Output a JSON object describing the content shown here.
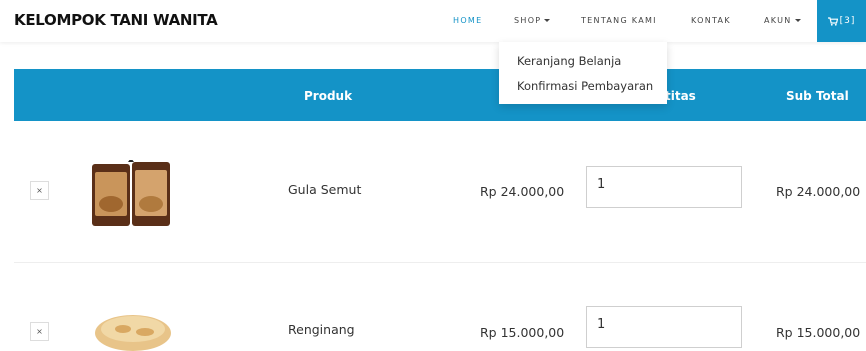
{
  "brand": "KELOMPOK TANI WANITA",
  "nav": {
    "home": "HOME",
    "shop": "SHOP",
    "tentang": "TENTANG KAMI",
    "kontak": "KONTAK",
    "akun": "AKUN",
    "cart_count": "[3]"
  },
  "dropdown": {
    "items": [
      "Keranjang Belanja",
      "Konfirmasi Pembayaran"
    ]
  },
  "table": {
    "headers": {
      "produk": "Produk",
      "kuantitas": "titas",
      "subtotal": "Sub Total"
    },
    "rows": [
      {
        "remove": "×",
        "name": "Gula Semut",
        "price": "Rp 24.000,00",
        "qty": "1",
        "subtotal": "Rp 24.000,00"
      },
      {
        "remove": "×",
        "name": "Renginang",
        "price": "Rp 15.000,00",
        "qty": "1",
        "subtotal": "Rp 15.000,00"
      }
    ]
  },
  "colors": {
    "accent": "#1493c7"
  }
}
